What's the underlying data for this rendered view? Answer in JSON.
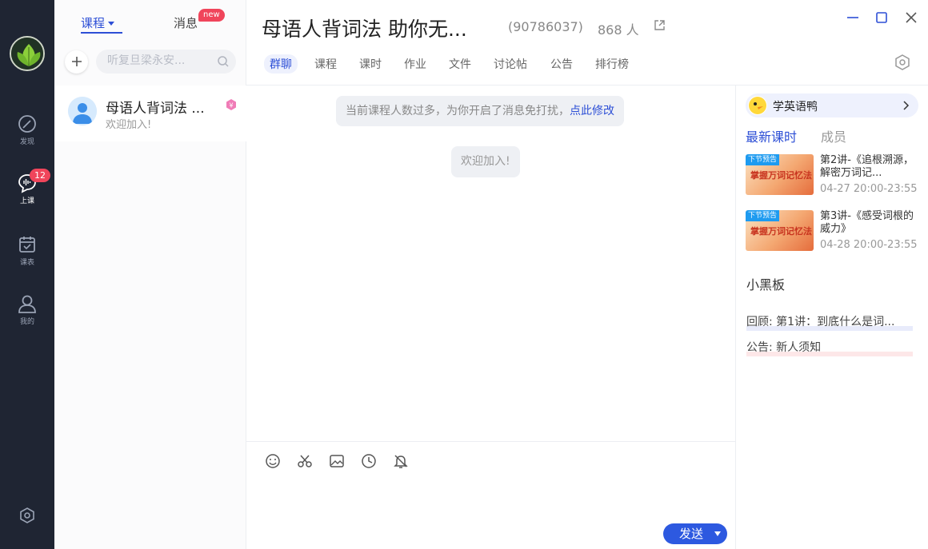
{
  "rail": {
    "items": [
      {
        "label": "发现"
      },
      {
        "label": "上课",
        "badge": "12"
      },
      {
        "label": "课表"
      },
      {
        "label": "我的"
      }
    ]
  },
  "sessions": {
    "tab_course": "课程",
    "tab_message": "消息",
    "new_badge": "new",
    "search_placeholder": "听复旦梁永安...",
    "items": [
      {
        "title": "母语人背词法 ...",
        "subtitle": "欢迎加入!"
      }
    ]
  },
  "header": {
    "title": "母语人背词法 助你无...",
    "group_id": "(90786037)",
    "member_count": "868 人",
    "tabs": [
      "群聊",
      "课程",
      "课时",
      "作业",
      "文件",
      "讨论帖",
      "公告",
      "排行榜"
    ]
  },
  "messages": {
    "notice_text": "当前课程人数过多，为你开启了消息免打扰，",
    "notice_link": "点此修改",
    "welcome": "欢迎加入!"
  },
  "composer": {
    "send_label": "发送"
  },
  "right_panel": {
    "duck_label": "学英语鸭",
    "tabs": [
      "最新课时",
      "成员"
    ],
    "lessons": [
      {
        "tag": "下节预告",
        "thumb_text": "掌握万词记忆法",
        "title": "第2讲-《追根溯源，解密万词记...",
        "time": "04-27 20:00-23:55"
      },
      {
        "tag": "下节预告",
        "thumb_text": "掌握万词记忆法",
        "title": "第3讲-《感受词根的威力》",
        "time": "04-28 20:00-23:55"
      }
    ],
    "board_title": "小黑板",
    "board_items": [
      {
        "text": "回顾: 第1讲：到底什么是词...",
        "accent": "#e8ebfb"
      },
      {
        "text": "公告: 新人须知",
        "accent": "#fde7e8"
      }
    ]
  },
  "colors": {
    "accent": "#2d4fd6",
    "rail_bg": "#1f2533",
    "badge": "#f0455b"
  }
}
